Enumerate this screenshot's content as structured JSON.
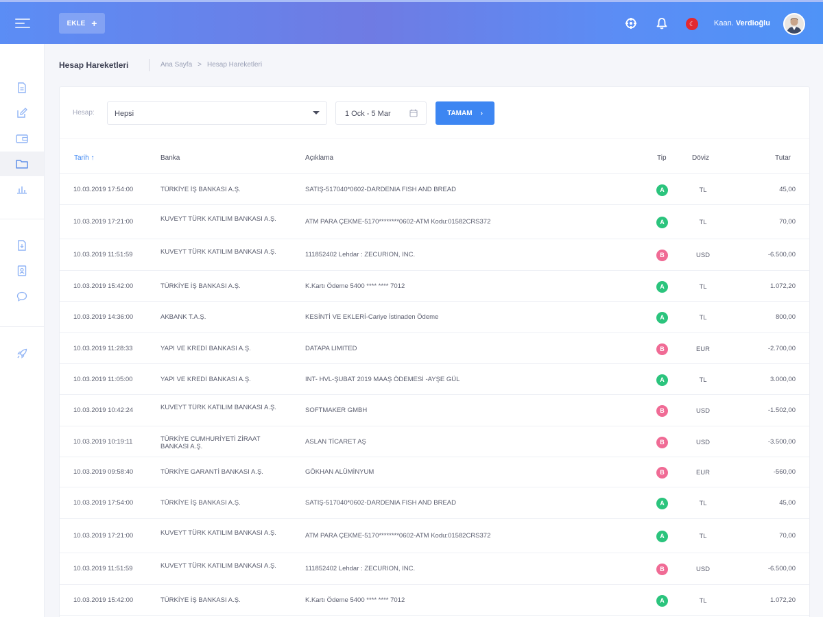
{
  "header": {
    "add_label": "EKLE",
    "add_icon": "plus-icon",
    "icons": [
      "crosshair-icon",
      "bell-icon",
      "flag-icon"
    ],
    "user_name_first": "Kaan",
    "user_name_last": "Verdioğlu",
    "gradient_colors": [
      "#5b8df5",
      "#6f7be3",
      "#4f93f7"
    ]
  },
  "sidebar": {
    "items": [
      {
        "icon": "document-icon"
      },
      {
        "icon": "edit-icon"
      },
      {
        "icon": "wallet-icon"
      },
      {
        "icon": "folder-icon",
        "active": true
      },
      {
        "icon": "bar-chart-icon"
      },
      {
        "icon": "file-download-icon"
      },
      {
        "icon": "contact-icon"
      },
      {
        "icon": "chat-icon"
      },
      {
        "icon": "rocket-icon"
      }
    ]
  },
  "page": {
    "title": "Hesap Hareketleri",
    "breadcrumb": [
      "Ana Sayfa",
      ">",
      "Hesap Hareketleri"
    ]
  },
  "filters": {
    "account_label": "Hesap:",
    "account_value": "Hepsi",
    "date_range": "1 Ock - 5 Mar",
    "ok_label": "TAMAM",
    "accent": "#3d86f2"
  },
  "table": {
    "headers": {
      "date": "Tarih",
      "bank": "Banka",
      "desc": "Açıklama",
      "type": "Tip",
      "currency": "Döviz",
      "amount": "Tutar"
    },
    "rows": [
      {
        "date": "10.03.2019  17:54:00",
        "bank": "TÜRKİYE İŞ BANKASI A.Ş.",
        "desc": "SATIŞ-517040*0602-DARDENIA FISH AND BREAD",
        "type": "A",
        "currency": "TL",
        "amount": "45,00"
      },
      {
        "date": "10.03.2019  17:21:00",
        "bank": "KUVEYT TÜRK KATILIM BANKASI A.Ş.",
        "desc": "ATM PARA ÇEKME-5170********0602-ATM Kodu:01582CRS372",
        "type": "A",
        "currency": "TL",
        "amount": "70,00"
      },
      {
        "date": "10.03.2019 11:51:59",
        "bank": "KUVEYT TÜRK KATILIM BANKASI A.Ş.",
        "desc": "111852402 Lehdar : ZECURION, INC.",
        "type": "B",
        "currency": "USD",
        "amount": "-6.500,00"
      },
      {
        "date": "10.03.2019  15:42:00",
        "bank": "TÜRKİYE İŞ BANKASI A.Ş.",
        "desc": "K.Kartı Ödeme 5400 **** **** 7012",
        "type": "A",
        "currency": "TL",
        "amount": "1.072,20"
      },
      {
        "date": "10.03.2019 14:36:00",
        "bank": "AKBANK T.A.Ş.",
        "desc": "KESİNTİ VE EKLERİ-Cariye İstinaden Ödeme",
        "type": "A",
        "currency": "TL",
        "amount": "800,00"
      },
      {
        "date": "10.03.2019 11:28:33",
        "bank": "YAPI VE KREDİ BANKASI A.Ş.",
        "desc": "DATAPA LIMITED",
        "type": "B",
        "currency": "EUR",
        "amount": "-2.700,00"
      },
      {
        "date": "10.03.2019 11:05:00",
        "bank": "YAPI VE KREDİ BANKASI A.Ş.",
        "desc": "INT-     HVL-ŞUBAT 2019 MAAŞ ÖDEMESİ        -AYŞE GÜL",
        "type": "A",
        "currency": "TL",
        "amount": "3.000,00"
      },
      {
        "date": "10.03.2019 10:42:24",
        "bank": "KUVEYT TÜRK KATILIM BANKASI A.Ş.",
        "desc": "SOFTMAKER GMBH",
        "type": "B",
        "currency": "USD",
        "amount": "-1.502,00"
      },
      {
        "date": "10.03.2019 10:19:11",
        "bank": "TÜRKİYE CUMHURİYETİ ZİRAAT BANKASI A.Ş.",
        "desc": "ASLAN TİCARET AŞ",
        "type": "B",
        "currency": "USD",
        "amount": "-3.500,00"
      },
      {
        "date": "10.03.2019 09:58:40",
        "bank": "TÜRKİYE GARANTİ BANKASI A.Ş.",
        "desc": "GÖKHAN ALÜMİNYUM",
        "type": "B",
        "currency": "EUR",
        "amount": "-560,00"
      },
      {
        "date": "10.03.2019  17:54:00",
        "bank": "TÜRKİYE İŞ BANKASI A.Ş.",
        "desc": "SATIŞ-517040*0602-DARDENIA FISH AND BREAD",
        "type": "A",
        "currency": "TL",
        "amount": "45,00"
      },
      {
        "date": "10.03.2019  17:21:00",
        "bank": "KUVEYT TÜRK KATILIM BANKASI A.Ş.",
        "desc": "ATM PARA ÇEKME-5170********0602-ATM Kodu:01582CRS372",
        "type": "A",
        "currency": "TL",
        "amount": "70,00"
      },
      {
        "date": "10.03.2019 11:51:59",
        "bank": "KUVEYT TÜRK KATILIM BANKASI A.Ş.",
        "desc": "111852402 Lehdar : ZECURION, INC.",
        "type": "B",
        "currency": "USD",
        "amount": "-6.500,00"
      },
      {
        "date": "10.03.2019  15:42:00",
        "bank": "TÜRKİYE İŞ BANKASI A.Ş.",
        "desc": "K.Kartı Ödeme 5400 **** **** 7012",
        "type": "A",
        "currency": "TL",
        "amount": "1.072,20"
      }
    ],
    "type_colors": {
      "A": "#2bc47d",
      "B": "#f06b95"
    }
  }
}
